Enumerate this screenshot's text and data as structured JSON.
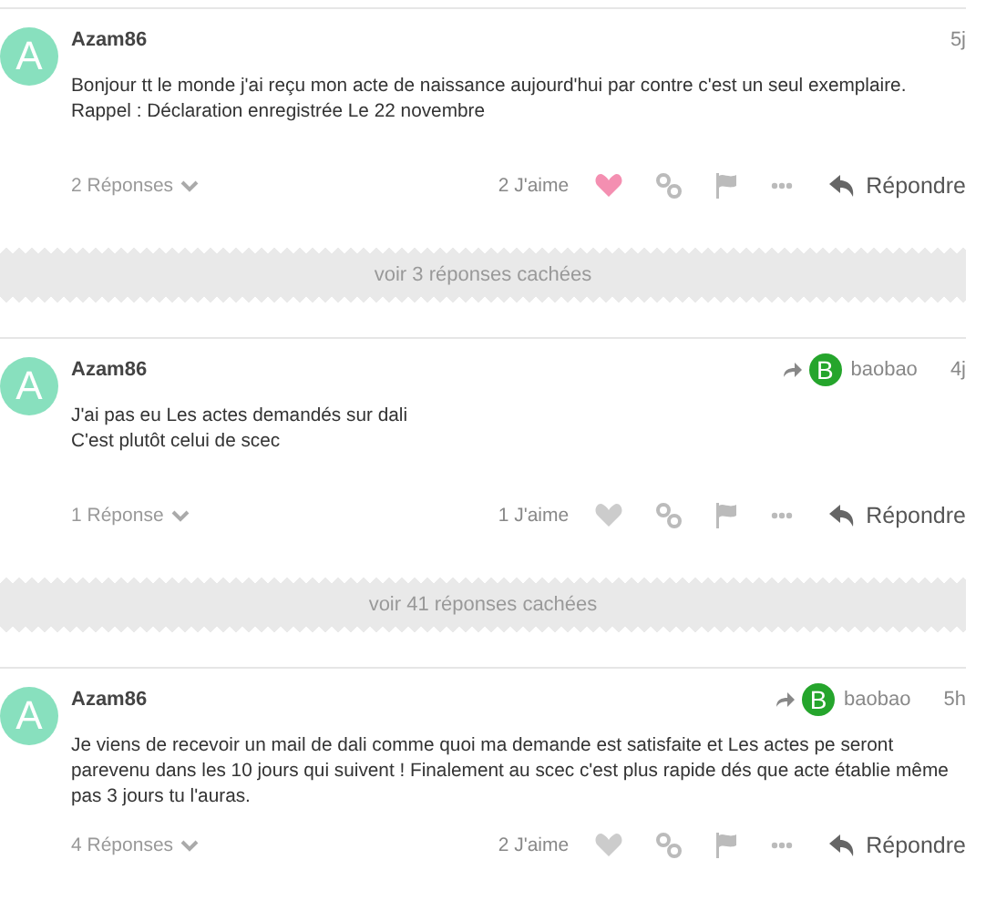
{
  "posts": [
    {
      "author": "Azam86",
      "avatar": {
        "letter": "A",
        "color": "#88e0be"
      },
      "time": "5j",
      "lines": [
        "Bonjour tt le monde j'ai reçu mon acte de naissance aujourd'hui par contre c'est un seul exemplaire.",
        "Rappel : Déclaration enregistrée Le 22 novembre"
      ],
      "replies": "2 Réponses",
      "likes": "2 J'aime",
      "liked": true,
      "reply_label": "Répondre"
    },
    {
      "hidden_replies": "voir 3 réponses cachées"
    },
    {
      "author": "Azam86",
      "avatar": {
        "letter": "A",
        "color": "#88e0be"
      },
      "reply_to": {
        "letter": "B",
        "color": "#25a52c",
        "name": "baobao"
      },
      "time": "4j",
      "lines": [
        "J'ai pas eu Les actes demandés sur dali",
        "C'est plutôt celui de scec"
      ],
      "replies": "1 Réponse",
      "likes": "1 J'aime",
      "liked": false,
      "reply_label": "Répondre"
    },
    {
      "hidden_replies": "voir 41 réponses cachées"
    },
    {
      "author": "Azam86",
      "avatar": {
        "letter": "A",
        "color": "#88e0be"
      },
      "reply_to": {
        "letter": "B",
        "color": "#25a52c",
        "name": "baobao"
      },
      "time": "5h",
      "lines": [
        "Je viens de recevoir un mail de dali comme quoi ma demande est satisfaite et Les actes pe seront parevenu dans les 10 jours qui suivent ! Finalement au scec c'est plus rapide dés que acte établie même pas 3 jours tu l'auras."
      ],
      "replies": "4 Réponses",
      "likes": "2 J'aime",
      "liked": false,
      "reply_label": "Répondre"
    }
  ]
}
